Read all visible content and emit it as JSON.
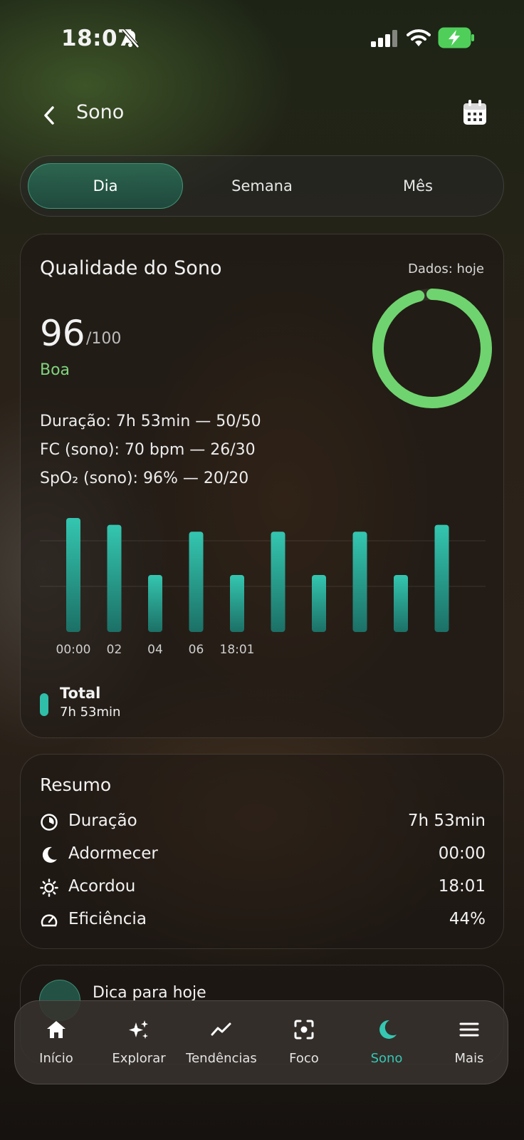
{
  "status_bar": {
    "time": "18:07",
    "icons": [
      "bell-slash-icon",
      "signal-icon",
      "wifi-icon",
      "battery-charging-icon"
    ]
  },
  "header": {
    "title": "Sono",
    "back_icon": "chevron-left-icon",
    "calendar_icon": "calendar-icon"
  },
  "tabs": [
    {
      "label": "Dia",
      "active": true
    },
    {
      "label": "Semana",
      "active": false
    },
    {
      "label": "Mês",
      "active": false
    }
  ],
  "quality": {
    "title": "Qualidade do Sono",
    "date_label": "Dados: hoje",
    "score": "96",
    "score_max": "/100",
    "score_fraction": 0.96,
    "rating": "Boa",
    "metrics": [
      "Duração: 7h 53min  —  50/50",
      "FC (sono): 70 bpm  —  26/30",
      "SpO₂ (sono): 96%  —  20/20"
    ],
    "legend": {
      "title": "Total",
      "value": "7h 53min"
    }
  },
  "chart_data": {
    "type": "bar",
    "x_tick_labels": [
      "00:00",
      "02",
      "04",
      "06",
      "18:01"
    ],
    "values": [
      1.0,
      0.94,
      0.5,
      0.88,
      0.5,
      0.88,
      0.5,
      0.88,
      0.5,
      0.94
    ],
    "ylim": [
      0,
      1
    ],
    "grid": true,
    "legend_position": "bottom-left",
    "colors": {
      "bar_top": "#34c6b0",
      "bar_bottom": "#1c7066"
    }
  },
  "summary": {
    "title": "Resumo",
    "rows": [
      {
        "icon": "clock-icon",
        "label": "Duração",
        "value": "7h 53min"
      },
      {
        "icon": "moon-icon",
        "label": "Adormecer",
        "value": "00:00"
      },
      {
        "icon": "sun-icon",
        "label": "Acordou",
        "value": "18:01"
      },
      {
        "icon": "gauge-icon",
        "label": "Eficiência",
        "value": "44%"
      }
    ]
  },
  "tip": {
    "title": "Dica para hoje",
    "icon": "sparkle-icon"
  },
  "bottom_nav": [
    {
      "label": "Início",
      "icon": "home-icon",
      "active": false
    },
    {
      "label": "Explorar",
      "icon": "sparkles-icon",
      "active": false
    },
    {
      "label": "Tendências",
      "icon": "trend-icon",
      "active": false
    },
    {
      "label": "Foco",
      "icon": "focus-icon",
      "active": false
    },
    {
      "label": "Sono",
      "icon": "moon-icon",
      "active": true
    },
    {
      "label": "Mais",
      "icon": "menu-icon",
      "active": false
    }
  ],
  "colors": {
    "accent": "#35c7b3",
    "score_ring": "#6fd46f",
    "rating": "#7fd47e"
  }
}
